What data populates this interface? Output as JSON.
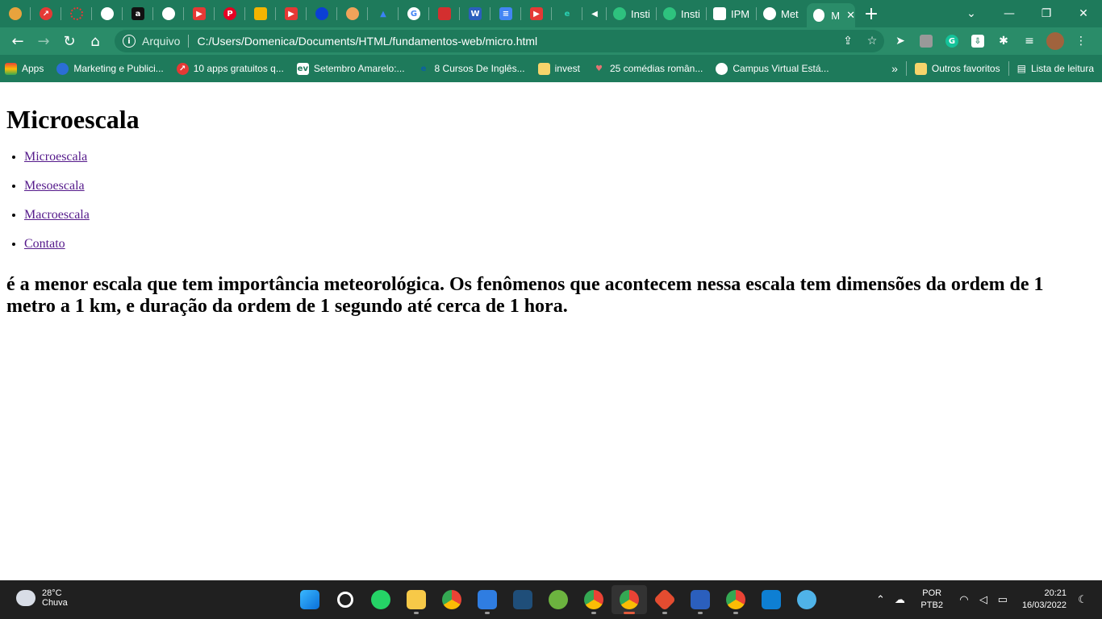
{
  "browser": {
    "tabs_text": [
      "Insti",
      "Insti",
      "IPM",
      "Met"
    ],
    "active_tab_label": "M",
    "new_tab": "+",
    "window_controls": {
      "dropdown": "⌄",
      "minimize": "—",
      "restore": "❐",
      "close": "✕"
    },
    "address": {
      "protocol_label": "Arquivo",
      "url": "C:/Users/Domenica/Documents/HTML/fundamentos-web/micro.html"
    },
    "bookmarks": [
      {
        "label": "Apps"
      },
      {
        "label": "Marketing e Publici..."
      },
      {
        "label": "10 apps gratuitos q..."
      },
      {
        "label": "Setembro Amarelo:..."
      },
      {
        "label": "8 Cursos De Inglês..."
      },
      {
        "label": "invest"
      },
      {
        "label": "25 comédias român..."
      },
      {
        "label": "Campus Virtual Está..."
      }
    ],
    "bookmarks_overflow": "»",
    "other_favorites": "Outros favoritos",
    "reading_list": "Lista de leitura"
  },
  "page": {
    "title": "Microescala",
    "nav": [
      "Microescala",
      "Mesoescala",
      "Macroescala",
      "Contato"
    ],
    "description": "é a menor escala que tem importância meteorológica. Os fenômenos que acontecem nessa escala tem dimensões da ordem de 1 metro a 1 km, e duração da ordem de 1 segundo até cerca de 1 hora."
  },
  "taskbar": {
    "weather": {
      "temp": "28°C",
      "condition": "Chuva"
    },
    "lang": {
      "line1": "POR",
      "line2": "PTB2"
    },
    "clock": {
      "time": "20:21",
      "date": "16/03/2022"
    }
  },
  "colors": {
    "chrome_bg": "#1e7a5b",
    "toolbar_bg": "#2a8c69",
    "link_visited": "#551a8b",
    "taskbar_bg": "#202020"
  }
}
